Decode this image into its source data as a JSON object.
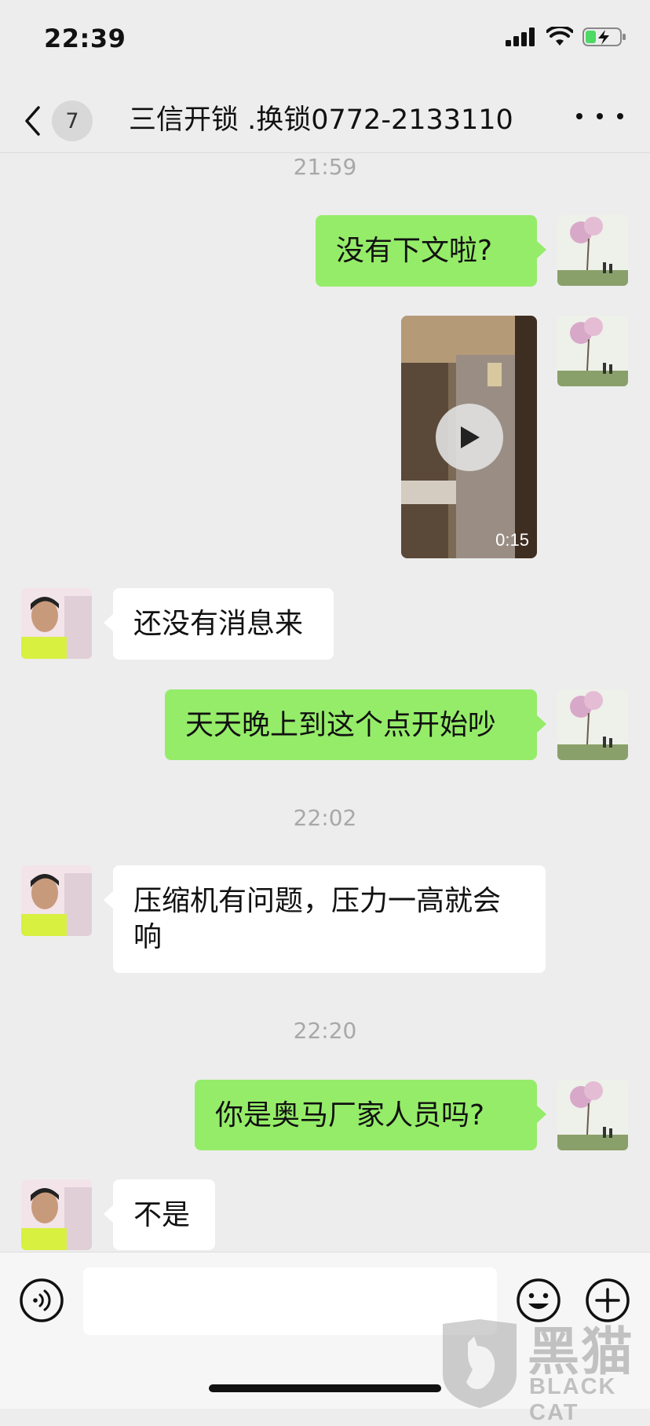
{
  "status_bar": {
    "time": "22:39",
    "icons": [
      "signal-icon",
      "wifi-icon",
      "battery-charging-icon"
    ]
  },
  "header": {
    "unread_count": "7",
    "title": "三信开锁 .换锁0772-2133110",
    "more_icon": "more-icon"
  },
  "messages": [
    {
      "type": "time",
      "text": "21:59"
    },
    {
      "type": "text",
      "from": "me",
      "text": "没有下文啦?"
    },
    {
      "type": "video",
      "from": "me",
      "duration": "0:15"
    },
    {
      "type": "text",
      "from": "other",
      "text": "还没有消息来"
    },
    {
      "type": "text",
      "from": "me",
      "text": "天天晚上到这个点开始吵"
    },
    {
      "type": "time",
      "text": "22:02"
    },
    {
      "type": "text",
      "from": "other",
      "text": "压缩机有问题，压力一高就会响"
    },
    {
      "type": "time",
      "text": "22:20"
    },
    {
      "type": "text",
      "from": "me",
      "text": "你是奥马厂家人员吗?"
    },
    {
      "type": "text",
      "from": "other",
      "text": "不是"
    }
  ],
  "input_bar": {
    "text_value": "",
    "voice_icon": "voice-icon",
    "emoji_icon": "emoji-icon",
    "plus_icon": "plus-icon"
  },
  "watermark": {
    "text": "黑猫",
    "subtext": "BLACK CAT"
  },
  "colors": {
    "background": "#ededed",
    "outgoing_bubble": "#95ec69",
    "incoming_bubble": "#ffffff",
    "timestamp": "#a8a8a8"
  }
}
